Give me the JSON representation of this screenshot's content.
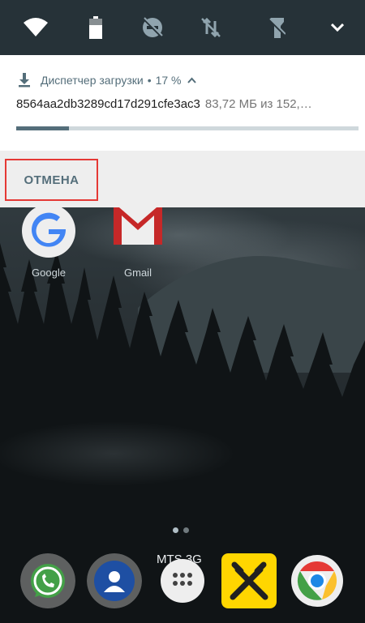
{
  "quick_settings": {
    "tiles": [
      {
        "name": "wifi-icon"
      },
      {
        "name": "battery-icon"
      },
      {
        "name": "dnd-off-icon"
      },
      {
        "name": "mobile-data-off-icon"
      },
      {
        "name": "flashlight-off-icon"
      },
      {
        "name": "expand-icon"
      }
    ]
  },
  "notification": {
    "app_name": "Диспетчер загрузки",
    "separator": "•",
    "percent": "17 %",
    "progress_fraction": 0.155,
    "file_name": "8564aa2db3289cd17d291cfe3ac3",
    "size_text": "83,72 МБ из 152,…",
    "action_cancel": "ОТМЕНА"
  },
  "home": {
    "apps": [
      {
        "label": "Google"
      },
      {
        "label": "Gmail"
      }
    ],
    "carrier": "MTS 3G",
    "dock": [
      "whatsapp-icon",
      "contacts-icon",
      "app-drawer-icon",
      "raiffeisen-icon",
      "chrome-icon"
    ]
  },
  "colors": {
    "accent": "#546e7a",
    "highlight": "#e53935"
  }
}
